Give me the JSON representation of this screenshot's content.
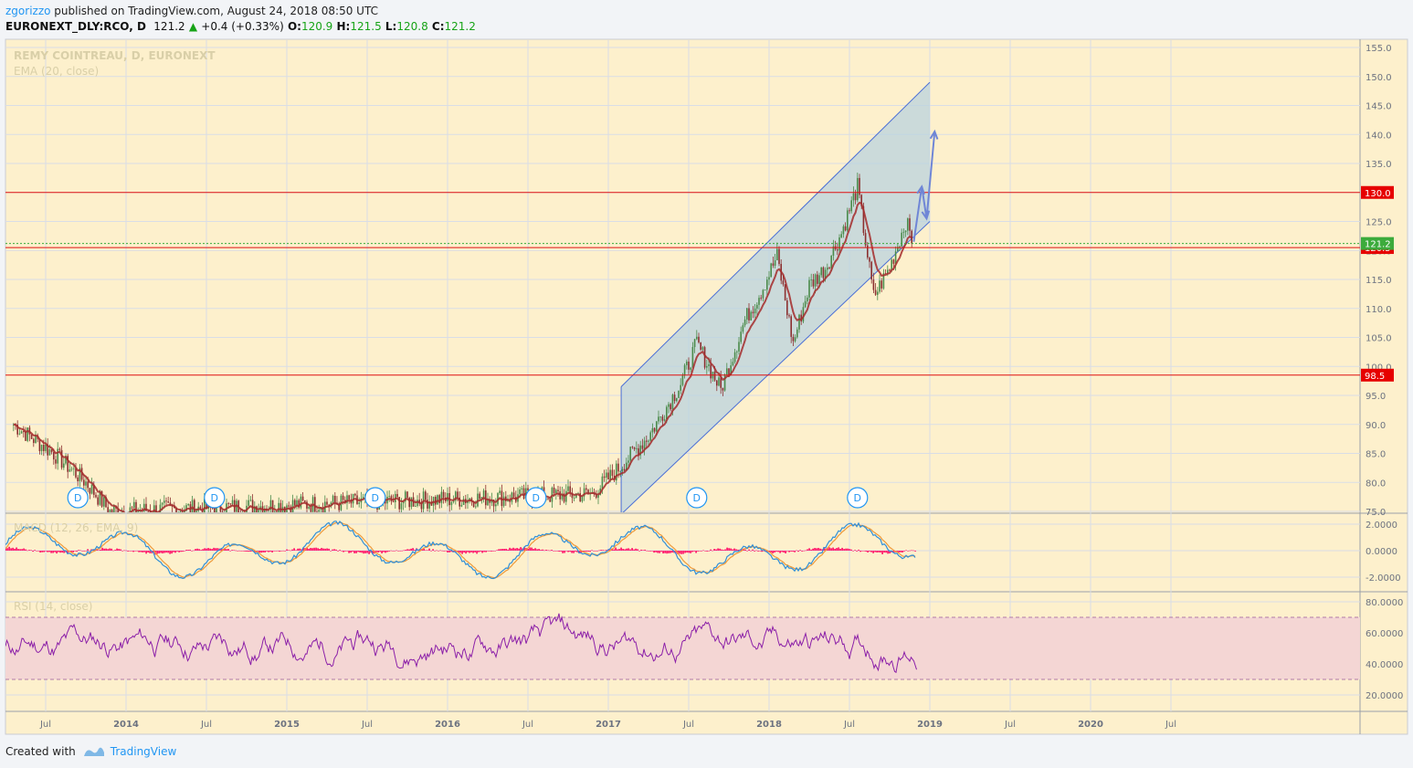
{
  "header": {
    "author": "zgorizzo",
    "published_text": "published on TradingView.com, August 24, 2018 08:50 UTC",
    "symbol": "EURONEXT_DLY:RCO, D",
    "last": "121.2",
    "change": "+0.4 (+0.33%)",
    "o_label": "O:",
    "o": "120.9",
    "h_label": "H:",
    "h": "121.5",
    "l_label": "L:",
    "l": "120.8",
    "c_label": "C:",
    "c": "121.2"
  },
  "footer": {
    "created_with": "Created with",
    "brand": "TradingView"
  },
  "colors": {
    "background": "#fdf0cc",
    "grid": "#d9dde6",
    "ema": "#a52a2a",
    "channel_fill": "#b9d3df",
    "channel_line": "#4a6ed6",
    "hline": "#e01010",
    "macd_line": "#2f8fd8",
    "signal_line": "#f09a3a",
    "histogram": "#ff1f6f",
    "rsi_line": "#8b1fa8",
    "rsi_band": "#f4d6d4",
    "last_price": "#3cab3c"
  },
  "chart_data": [
    {
      "type": "candlestick",
      "title": "REMY COINTREAU, D, EURONEXT",
      "indicator": "EMA (20, close)",
      "y_ticks": [
        "155.0",
        "150.0",
        "145.0",
        "140.0",
        "135.0",
        "130.0",
        "125.0",
        "120.0",
        "115.0",
        "110.0",
        "105.0",
        "100.0",
        "95.0",
        "90.0",
        "85.0",
        "80.0",
        "75.0"
      ],
      "ylim": [
        74.5,
        155.5
      ],
      "x_ticks": [
        "Jul",
        "2014",
        "Jul",
        "2015",
        "Jul",
        "2016",
        "Jul",
        "2017",
        "Jul",
        "2018",
        "Jul",
        "2019",
        "Jul",
        "2020",
        "Jul"
      ],
      "price_path_approx": [
        {
          "t": 2013.3,
          "v": 90
        },
        {
          "t": 2013.55,
          "v": 85
        },
        {
          "t": 2013.75,
          "v": 80
        },
        {
          "t": 2013.9,
          "v": 75
        },
        {
          "t": 2016.9,
          "v": 78
        },
        {
          "t": 2017.05,
          "v": 82
        },
        {
          "t": 2017.25,
          "v": 88
        },
        {
          "t": 2017.45,
          "v": 97
        },
        {
          "t": 2017.55,
          "v": 104
        },
        {
          "t": 2017.7,
          "v": 96
        },
        {
          "t": 2017.85,
          "v": 108
        },
        {
          "t": 2017.95,
          "v": 113
        },
        {
          "t": 2018.05,
          "v": 119
        },
        {
          "t": 2018.15,
          "v": 104
        },
        {
          "t": 2018.25,
          "v": 114
        },
        {
          "t": 2018.35,
          "v": 117
        },
        {
          "t": 2018.45,
          "v": 123
        },
        {
          "t": 2018.55,
          "v": 131
        },
        {
          "t": 2018.65,
          "v": 112
        },
        {
          "t": 2018.75,
          "v": 117
        },
        {
          "t": 2018.85,
          "v": 125
        },
        {
          "t": 2018.9,
          "v": 121
        }
      ],
      "horizontal_levels": [
        {
          "value": 130.0,
          "label": "130.0"
        },
        {
          "value": 120.5,
          "label": "120.5"
        },
        {
          "value": 98.5,
          "label": "98.5"
        }
      ],
      "last_price": {
        "value": 121.2,
        "label": "121.2"
      },
      "channel": {
        "upper": [
          {
            "t": 2017.08,
            "v": 96.5
          },
          {
            "t": 2019.0,
            "v": 149.0
          }
        ],
        "lower": [
          {
            "t": 2017.08,
            "v": 74.5
          },
          {
            "t": 2019.0,
            "v": 125.0
          }
        ]
      },
      "projection_arrows": [
        {
          "t": 2018.9,
          "v": 121.5
        },
        {
          "t": 2018.95,
          "v": 131
        },
        {
          "t": 2018.98,
          "v": 125.5
        },
        {
          "t": 2019.03,
          "v": 140.5
        }
      ],
      "dividend_markers": [
        {
          "t": 2013.7,
          "label": "D"
        },
        {
          "t": 2014.55,
          "label": "D"
        },
        {
          "t": 2015.55,
          "label": "D"
        },
        {
          "t": 2016.55,
          "label": "D"
        },
        {
          "t": 2017.55,
          "label": "D"
        },
        {
          "t": 2018.55,
          "label": "D"
        }
      ]
    },
    {
      "type": "line",
      "title": "MACD (12, 26, EMA, 9)",
      "y_ticks": [
        "2.0000",
        "0.0000",
        "-2.0000"
      ],
      "ylim": [
        -2.6,
        2.6
      ]
    },
    {
      "type": "line",
      "title": "RSI (14, close)",
      "y_ticks": [
        "80.0000",
        "60.0000",
        "40.0000",
        "20.0000"
      ],
      "ylim": [
        10,
        85
      ],
      "band": [
        30,
        70
      ]
    }
  ]
}
